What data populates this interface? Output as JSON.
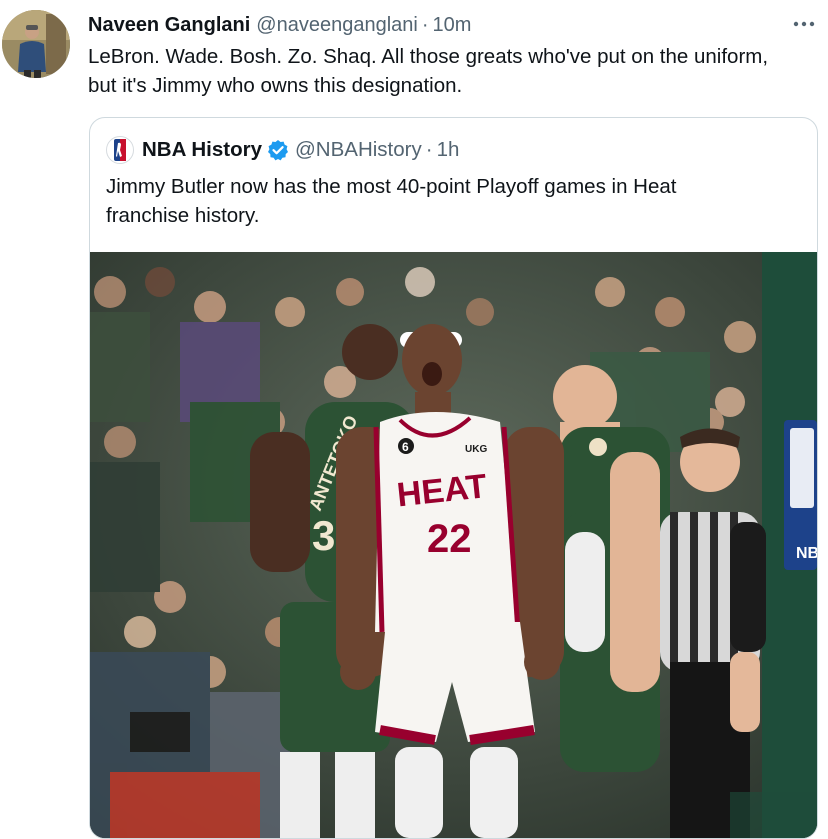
{
  "tweet": {
    "author_name": "Naveen Ganglani",
    "author_handle": "@naveenganglani",
    "separator": "·",
    "time": "10m",
    "text": "LeBron. Wade. Bosh. Zo. Shaq. All those greats who've put on the uniform,\nbut it's Jimmy who owns this designation."
  },
  "quote": {
    "author_name": "NBA History",
    "author_handle": "@NBAHistory",
    "separator": "·",
    "time": "1h",
    "text": "Jimmy Butler now has the most 40-point Playoff games in Heat\nfranchise history.",
    "photo": {
      "jersey_team": "HEAT",
      "jersey_number": "22",
      "jersey_patch": "6",
      "jersey_sponsor": "UKG",
      "opponent_name": "ANTETOKO",
      "opponent_number": "3",
      "court_sign": "NB"
    }
  },
  "icons": {
    "more": "more-dots-icon",
    "verified": "verified-badge-icon",
    "logo": "nba-logo-icon"
  },
  "colors": {
    "verified": "#1d9bf0",
    "heat_red": "#98002e",
    "bucks_green": "#2c5234"
  }
}
